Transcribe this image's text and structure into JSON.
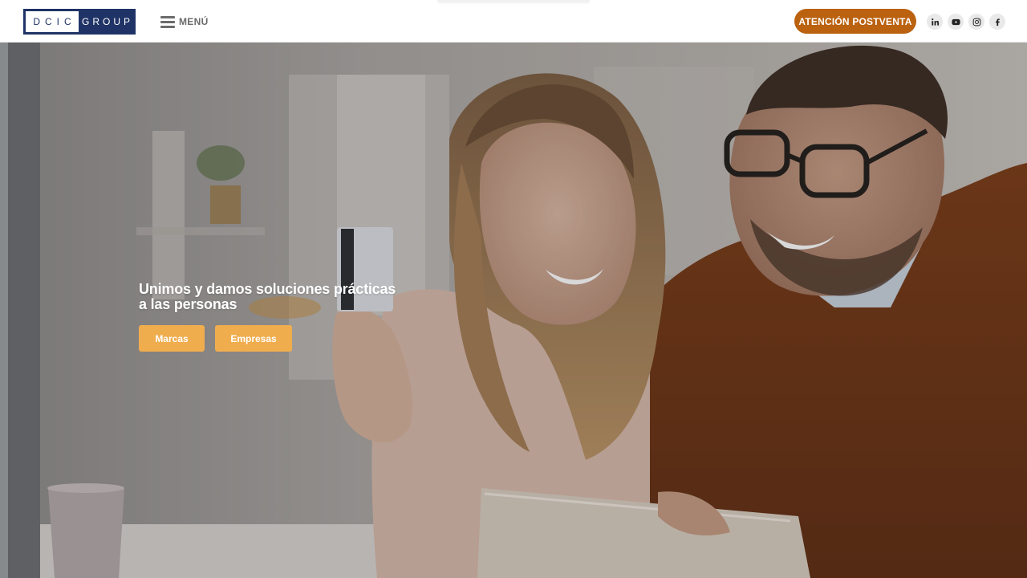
{
  "header": {
    "logo": {
      "left_text": "DCIC",
      "right_text": "GROUP"
    },
    "menu_label": "MENÚ",
    "cta_label": "ATENCIÓN POSTVENTA",
    "social": [
      "linkedin-icon",
      "youtube-icon",
      "instagram-icon",
      "facebook-icon"
    ]
  },
  "hero": {
    "headline_line1": "Unimos y damos soluciones prácticas",
    "headline_line2": "a las personas",
    "buttons": [
      {
        "label": "Marcas"
      },
      {
        "label": "Empresas"
      }
    ]
  },
  "colors": {
    "brand_navy": "#1f3366",
    "cta_brown": "#bb6210",
    "hero_button": "#f0ad4e",
    "menu_gray": "#6b6b6b"
  }
}
